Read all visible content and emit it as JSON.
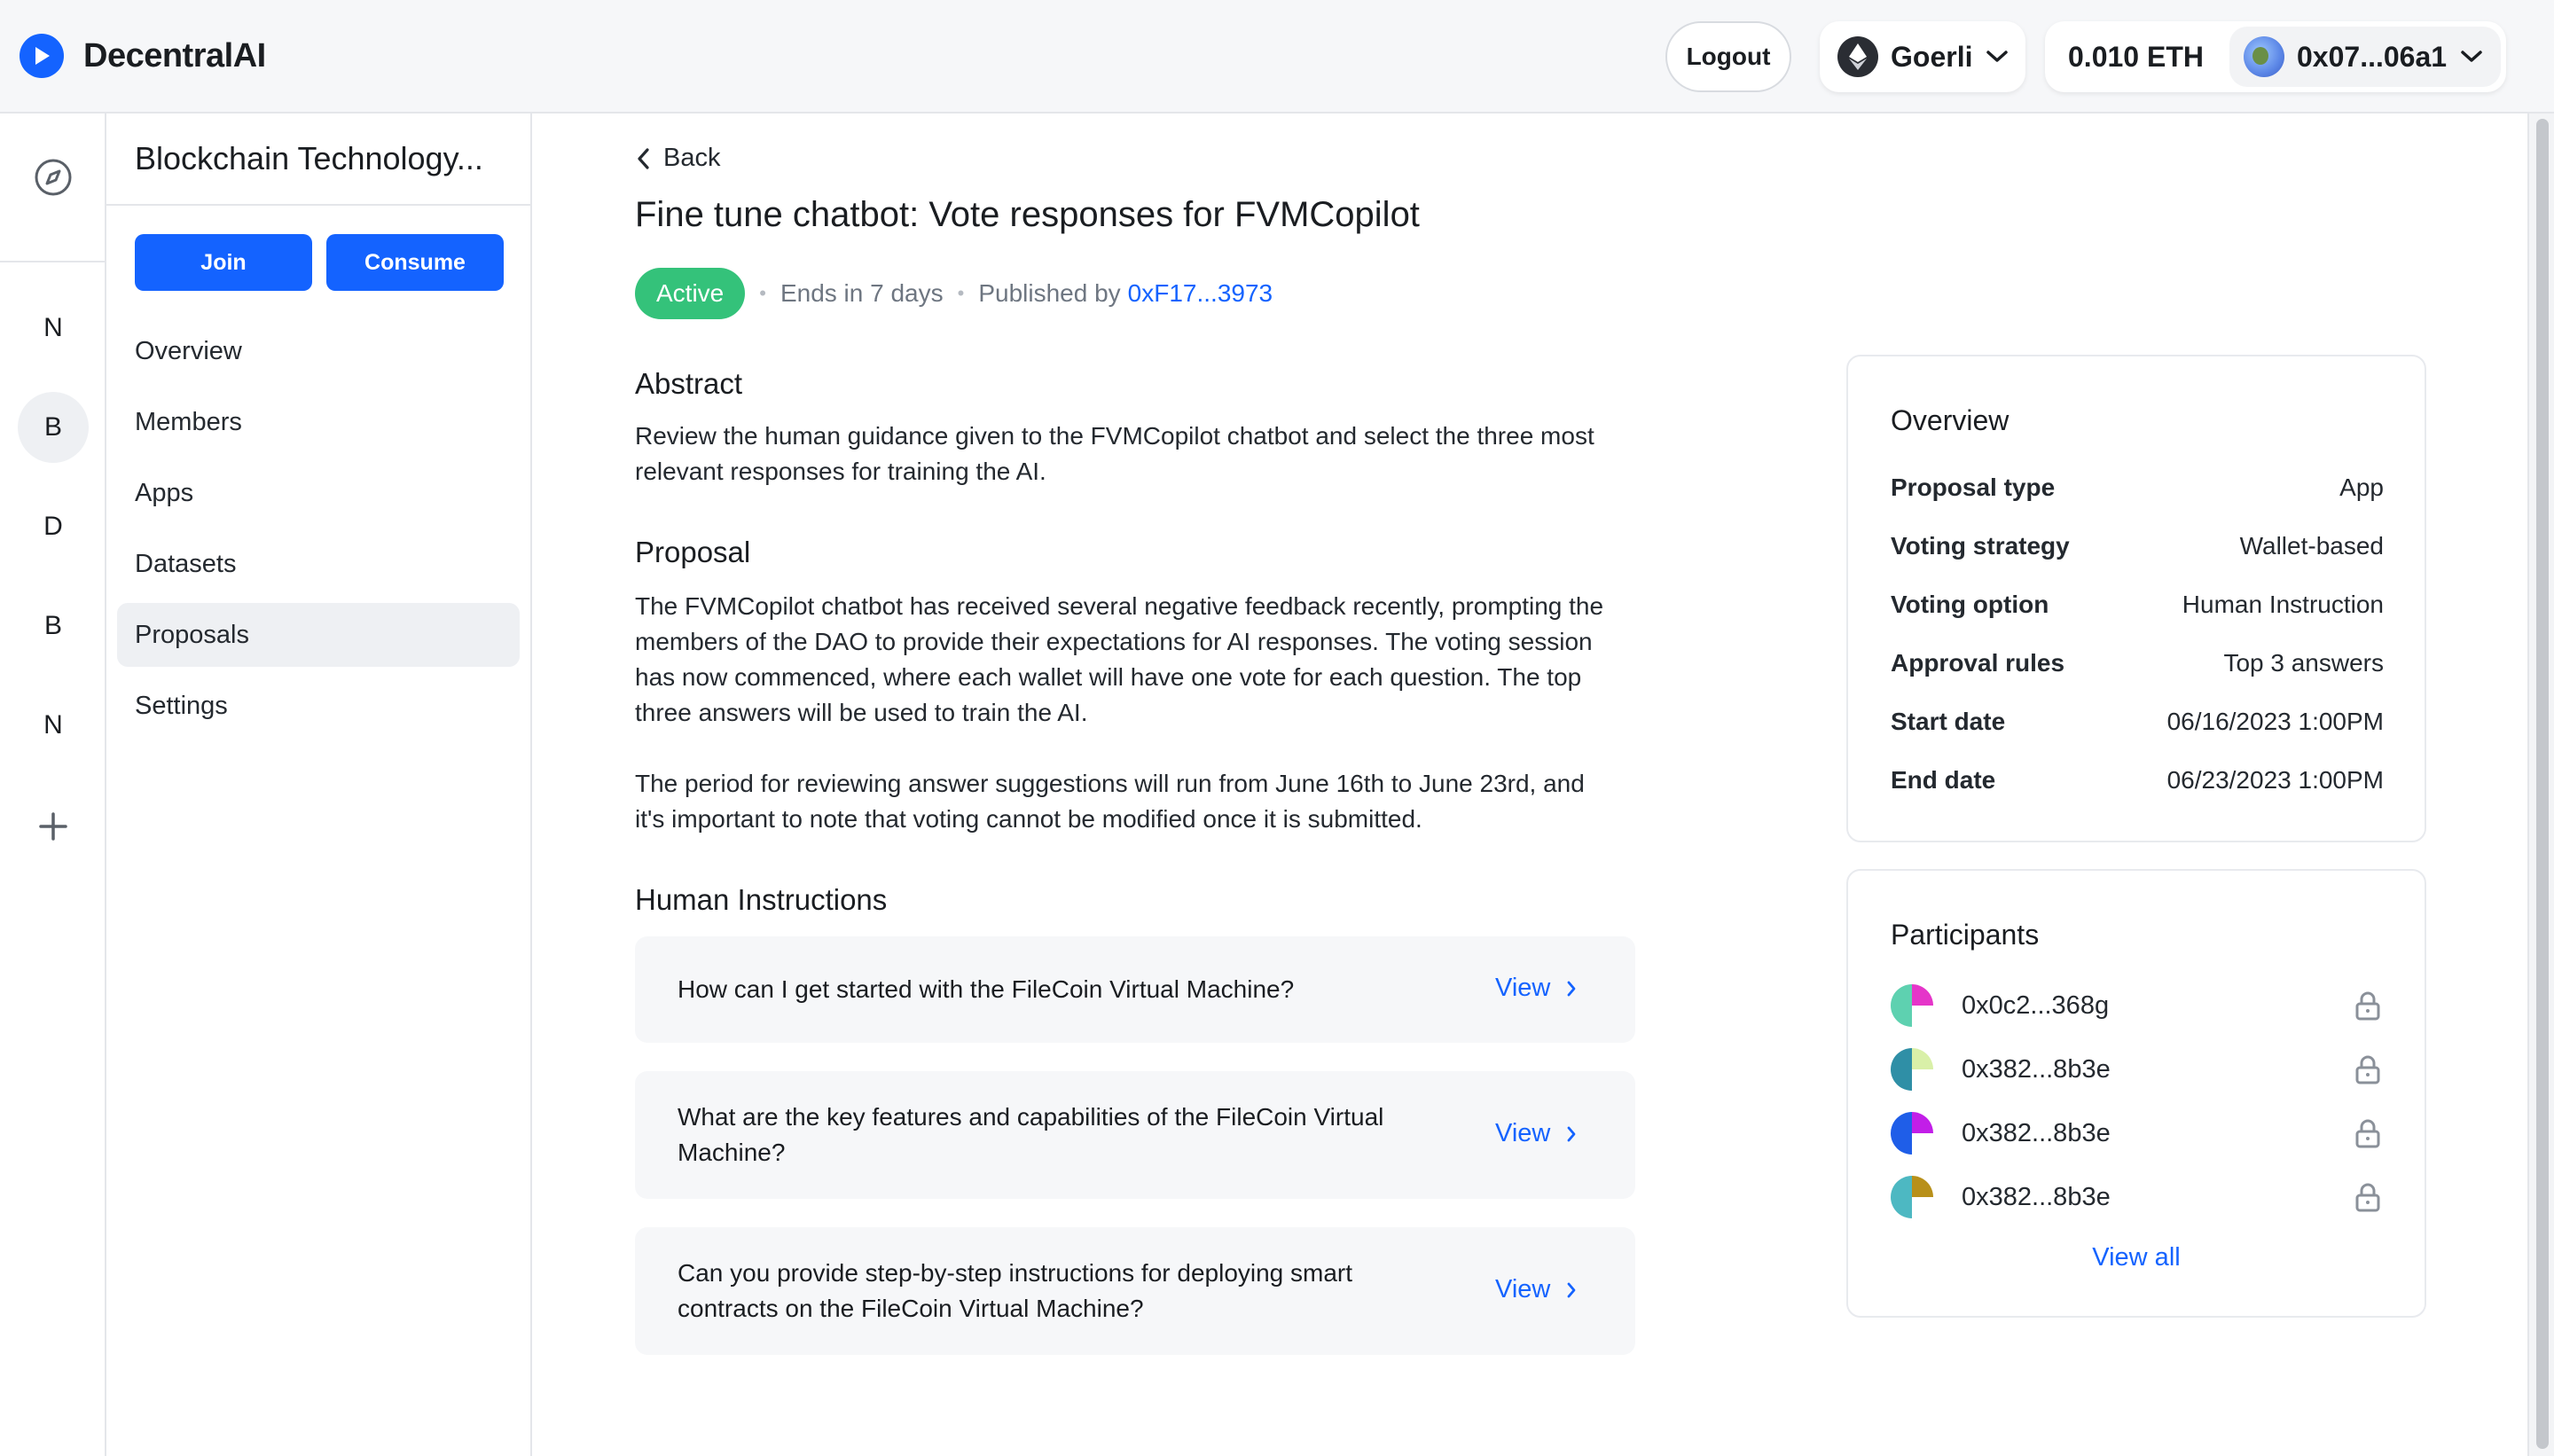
{
  "app": {
    "name": "DecentralAI"
  },
  "header": {
    "logout_label": "Logout",
    "network_name": "Goerli",
    "balance": "0.010 ETH",
    "account_address": "0x07...06a1"
  },
  "rail": {
    "items": [
      {
        "label": "N",
        "active": false
      },
      {
        "label": "B",
        "active": true
      },
      {
        "label": "D",
        "active": false
      },
      {
        "label": "B",
        "active": false
      },
      {
        "label": "N",
        "active": false
      }
    ]
  },
  "sidebar": {
    "dao_title": "Blockchain Technology...",
    "join_label": "Join",
    "consume_label": "Consume",
    "nav": [
      {
        "label": "Overview",
        "active": false
      },
      {
        "label": "Members",
        "active": false
      },
      {
        "label": "Apps",
        "active": false
      },
      {
        "label": "Datasets",
        "active": false
      },
      {
        "label": "Proposals",
        "active": true
      },
      {
        "label": "Settings",
        "active": false
      }
    ]
  },
  "proposal": {
    "back_label": "Back",
    "title": "Fine tune chatbot: Vote responses for FVMCopilot",
    "status": "Active",
    "ends_in": "Ends in 7 days",
    "published_by_label": "Published by",
    "publisher": "0xF17...3973",
    "abstract_heading": "Abstract",
    "abstract": "Review the human guidance given to the FVMCopilot chatbot and select the three most relevant responses for training the AI.",
    "proposal_heading": "Proposal",
    "proposal_p1": "The FVMCopilot chatbot has received several negative feedback recently, prompting the members of the DAO to provide their expectations for AI responses. The voting session has now commenced, where each wallet will have one vote for each question. The top three answers will be used to train the AI.",
    "proposal_p2": "The period for reviewing answer suggestions will run from June 16th to June 23rd, and it's important to note that voting cannot be modified once it is submitted.",
    "instructions_heading": "Human Instructions",
    "instructions": [
      {
        "question": "How can I get started with the FileCoin Virtual Machine?",
        "action": "View"
      },
      {
        "question": "What are the key features and capabilities of the FileCoin Virtual Machine?",
        "action": "View"
      },
      {
        "question": "Can you provide step-by-step instructions for deploying smart contracts on the FileCoin Virtual Machine?",
        "action": "View"
      }
    ]
  },
  "overview": {
    "heading": "Overview",
    "rows": [
      {
        "key": "Proposal type",
        "value": "App"
      },
      {
        "key": "Voting strategy",
        "value": "Wallet-based"
      },
      {
        "key": "Voting option",
        "value": "Human Instruction"
      },
      {
        "key": "Approval rules",
        "value": "Top 3 answers"
      },
      {
        "key": "Start date",
        "value": "06/16/2023 1:00PM"
      },
      {
        "key": "End date",
        "value": "06/23/2023 1:00PM"
      }
    ]
  },
  "participants": {
    "heading": "Participants",
    "list": [
      {
        "address": "0x0c2...368g",
        "colors": [
          "#e535c9",
          "#5ed1b0"
        ]
      },
      {
        "address": "0x382...8b3e",
        "colors": [
          "#d9f0a8",
          "#2f8fa6"
        ]
      },
      {
        "address": "0x382...8b3e",
        "colors": [
          "#c21ee8",
          "#1f5ee8"
        ]
      },
      {
        "address": "0x382...8b3e",
        "colors": [
          "#b8901a",
          "#4db8c2"
        ]
      }
    ],
    "view_all_label": "View all"
  },
  "colors": {
    "accent": "#1463ff",
    "status_active": "#34c27a"
  }
}
